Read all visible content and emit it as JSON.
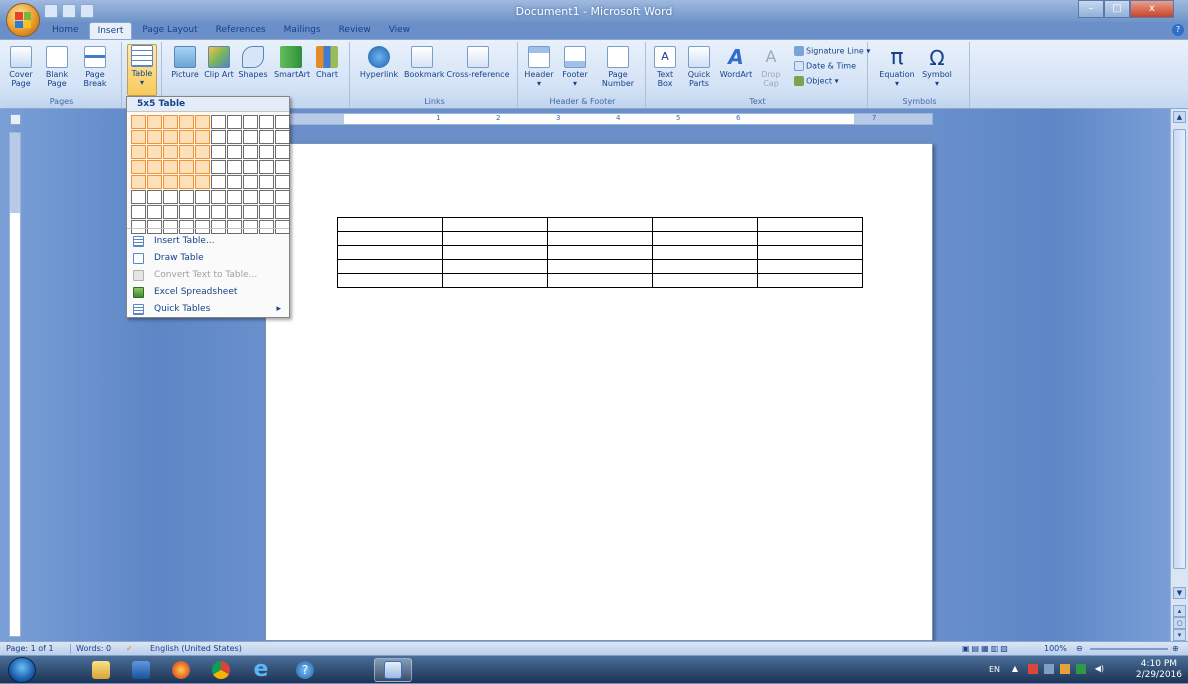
{
  "window": {
    "title": "Document1 - Microsoft Word",
    "controls": [
      "–",
      "□",
      "x"
    ]
  },
  "ribbon_tabs": [
    {
      "label": "Home"
    },
    {
      "label": "Insert"
    },
    {
      "label": "Page Layout"
    },
    {
      "label": "References"
    },
    {
      "label": "Mailings"
    },
    {
      "label": "Review"
    },
    {
      "label": "View"
    }
  ],
  "active_tab": "Insert",
  "ribbon": {
    "pages": {
      "label": "Pages",
      "cover_page": "Cover Page",
      "blank_page": "Blank Page",
      "page_break": "Page Break"
    },
    "tables": {
      "table": "Table"
    },
    "illustrations": {
      "picture": "Picture",
      "clip_art": "Clip Art",
      "shapes": "Shapes",
      "smartart": "SmartArt",
      "chart": "Chart"
    },
    "links": {
      "label": "Links",
      "hyperlink": "Hyperlink",
      "bookmark": "Bookmark",
      "cross_reference": "Cross-reference"
    },
    "header_footer": {
      "label": "Header & Footer",
      "header": "Header",
      "footer": "Footer",
      "page_number": "Page Number"
    },
    "text": {
      "label": "Text",
      "text_box": "Text Box",
      "quick_parts": "Quick Parts",
      "wordart": "WordArt",
      "drop_cap": "Drop Cap",
      "signature_line": "Signature Line",
      "date_time": "Date & Time",
      "object": "Object"
    },
    "symbols": {
      "label": "Symbols",
      "equation": "Equation",
      "symbol": "Symbol",
      "pi_glyph": "π",
      "omega_glyph": "Ω"
    }
  },
  "table_menu": {
    "header": "5x5 Table",
    "grid": {
      "columns": 10,
      "rows": 8,
      "selected_columns": 5,
      "selected_rows": 5
    },
    "items": [
      {
        "label": "Insert Table...",
        "enabled": true,
        "submenu": false
      },
      {
        "label": "Draw Table",
        "enabled": true,
        "submenu": false
      },
      {
        "label": "Convert Text to Table...",
        "enabled": false,
        "submenu": false
      },
      {
        "label": "Excel Spreadsheet",
        "enabled": true,
        "submenu": false
      },
      {
        "label": "Quick Tables",
        "enabled": true,
        "submenu": true
      }
    ]
  },
  "document": {
    "table": {
      "rows": 5,
      "columns": 5
    }
  },
  "ruler": {
    "numbers": [
      "1",
      "2",
      "3",
      "4",
      "5",
      "6",
      "7"
    ]
  },
  "statusbar": {
    "page": "Page: 1 of 1",
    "words": "Words: 0",
    "language": "English (United States)",
    "zoom": "100%"
  },
  "taskbar": {
    "language": "EN",
    "time": "4:10 PM",
    "date": "2/29/2016"
  },
  "colors": {
    "accent": "#15428b",
    "grid_highlight": "#f29436",
    "ribbon_bg": "#d3e2f5"
  }
}
